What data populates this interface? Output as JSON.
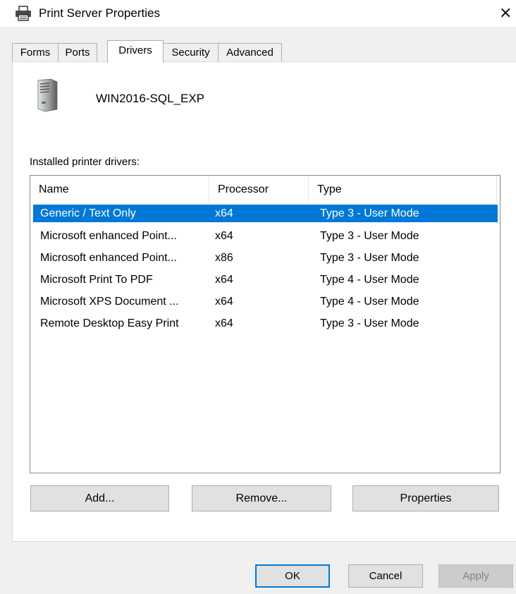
{
  "window": {
    "title": "Print Server Properties",
    "close_glyph": "×",
    "icon": "printer-icon"
  },
  "tabs": [
    {
      "label": "Forms",
      "active": false
    },
    {
      "label": "Ports",
      "active": false
    },
    {
      "label": "Drivers",
      "active": true
    },
    {
      "label": "Security",
      "active": false
    },
    {
      "label": "Advanced",
      "active": false
    }
  ],
  "server": {
    "icon": "server-tower-icon",
    "name": "WIN2016-SQL_EXP"
  },
  "drivers_list": {
    "label": "Installed printer drivers:",
    "columns": [
      "Name",
      "Processor",
      "Type"
    ],
    "rows": [
      {
        "name": "Generic / Text Only",
        "processor": "x64",
        "type": "Type 3 - User Mode",
        "selected": true
      },
      {
        "name": "Microsoft enhanced Point...",
        "processor": "x64",
        "type": "Type 3 - User Mode",
        "selected": false
      },
      {
        "name": "Microsoft enhanced Point...",
        "processor": "x86",
        "type": "Type 3 - User Mode",
        "selected": false
      },
      {
        "name": "Microsoft Print To PDF",
        "processor": "x64",
        "type": "Type 4 - User Mode",
        "selected": false
      },
      {
        "name": "Microsoft XPS Document ...",
        "processor": "x64",
        "type": "Type 4 - User Mode",
        "selected": false
      },
      {
        "name": "Remote Desktop Easy Print",
        "processor": "x64",
        "type": "Type 3 - User Mode",
        "selected": false
      }
    ],
    "selection_color": "#0078d7"
  },
  "actions": {
    "add": "Add...",
    "remove": "Remove...",
    "properties": "Properties"
  },
  "footer": {
    "ok": "OK",
    "cancel": "Cancel",
    "apply": "Apply",
    "apply_disabled": true
  }
}
